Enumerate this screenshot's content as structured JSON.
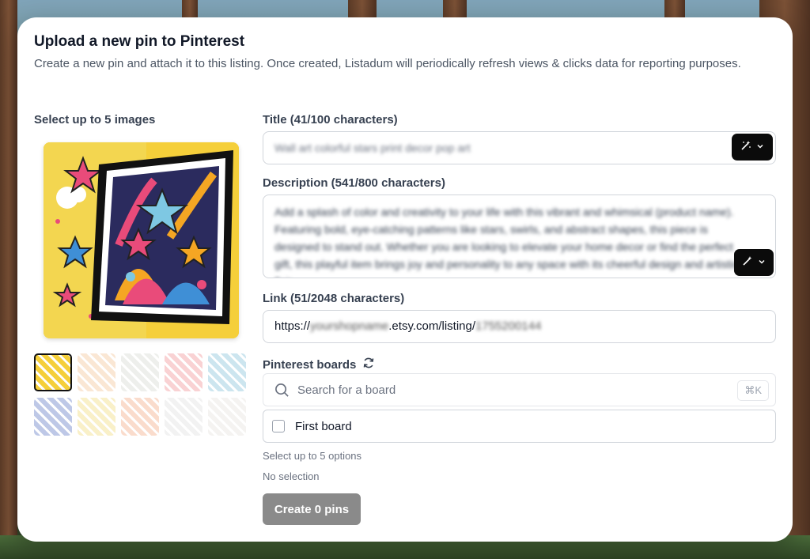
{
  "modal": {
    "title": "Upload a new pin to Pinterest",
    "subtitle": "Create a new pin and attach it to this listing. Once created, Listadum will periodically refresh views & clicks data for reporting purposes."
  },
  "images": {
    "label": "Select up to 5 images",
    "thumbnails": [
      {
        "color": "#f5cf3a",
        "selected": true
      },
      {
        "color": "#f3c9a0",
        "selected": false
      },
      {
        "color": "#d8dcd4",
        "selected": false
      },
      {
        "color": "#f29a9e",
        "selected": false
      },
      {
        "color": "#8fc6dc",
        "selected": false
      },
      {
        "color": "#6f86c9",
        "selected": false
      },
      {
        "color": "#f2dd86",
        "selected": false
      },
      {
        "color": "#f5b18f",
        "selected": false
      },
      {
        "color": "#e2e2e2",
        "selected": false
      },
      {
        "color": "#e8e4e0",
        "selected": false
      }
    ]
  },
  "form": {
    "title_label": "Title (41/100 characters)",
    "title_value": "Wall art colorful stars print decor pop art",
    "description_label": "Description (541/800 characters)",
    "description_value": "Add a splash of color and creativity to your life with this vibrant and whimsical (product name). Featuring bold, eye-catching patterns like stars, swirls, and abstract shapes, this piece is designed to stand out. Whether you are looking to elevate your home decor or find the perfect gift, this playful item brings joy and personality to any space with its cheerful design and artistic flair.",
    "link_label": "Link (51/2048 characters)",
    "link_prefix": "https://",
    "link_shop": "yourshopname",
    "link_middle": ".etsy.com/listing/",
    "link_id": "1755200144",
    "boards_label": "Pinterest boards",
    "search_placeholder": "Search for a board",
    "search_shortcut": "⌘K",
    "boards": [
      {
        "name": "First board",
        "checked": false
      }
    ],
    "hint": "Select up to 5 options",
    "selection_status": "No selection",
    "create_label": "Create 0 pins"
  },
  "icons": {
    "magic": "magic-wand-icon",
    "chevron": "chevron-down-icon",
    "refresh": "refresh-icon",
    "search": "search-icon"
  },
  "colors": {
    "primary_button": "#0b0b0b",
    "disabled_button": "#8a8a8a"
  }
}
